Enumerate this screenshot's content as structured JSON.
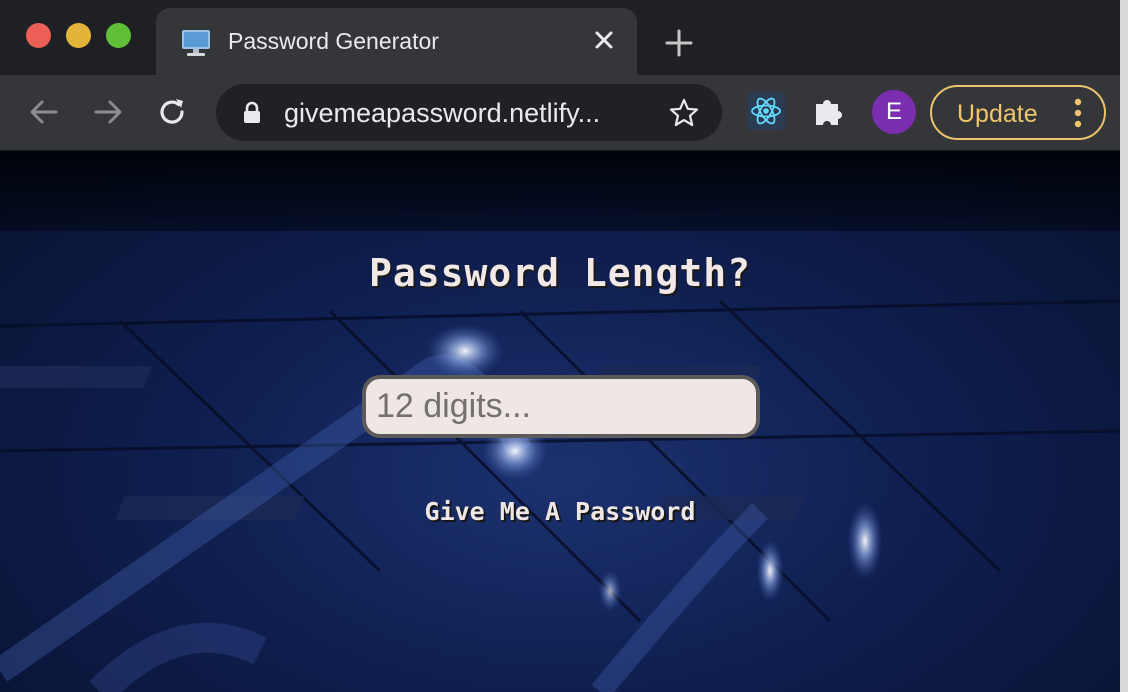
{
  "browser": {
    "tab": {
      "title": "Password Generator",
      "favicon": "monitor-icon"
    },
    "address_bar": {
      "url": "givemeapassword.netlify..."
    },
    "profile_initial": "E",
    "update_label": "Update",
    "colors": {
      "tab_active": "#35363a",
      "tab_strip": "#1f2023",
      "update_accent": "#f1c56b",
      "avatar": "#7b2fb0"
    }
  },
  "page": {
    "heading": "Password Length?",
    "input": {
      "placeholder": "12 digits...",
      "value": ""
    },
    "button_label": "Give Me A Password"
  }
}
